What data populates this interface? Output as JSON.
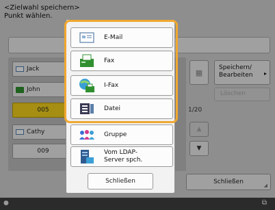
{
  "header": {
    "title_line1": "<Zielwahl speichern>",
    "title_line2": "Punkt wählen."
  },
  "list": {
    "rows": [
      {
        "label": "Jack",
        "icon": "address-card-icon",
        "selected": false
      },
      {
        "label": "John",
        "icon": "fax-icon",
        "selected": false
      },
      {
        "label": "005",
        "icon": "",
        "selected": true
      },
      {
        "label": "Cathy",
        "icon": "address-card-icon",
        "selected": false
      },
      {
        "label": "009",
        "icon": "",
        "selected": false
      }
    ]
  },
  "pager": {
    "indicator": "1/20",
    "up_icon": "triangle-up-icon",
    "down_icon": "triangle-down-icon"
  },
  "side": {
    "save_label_line1": "Speichern/",
    "save_label_line2": "Bearbeiten",
    "delete_label": "Löschen",
    "close_label": "Schließen",
    "arrow": "▸"
  },
  "popup": {
    "items": [
      {
        "label": "E-Mail",
        "icon": "email-icon"
      },
      {
        "label": "Fax",
        "icon": "fax-icon"
      },
      {
        "label": "I-Fax",
        "icon": "ifax-icon"
      },
      {
        "label": "Datei",
        "icon": "file-icon"
      },
      {
        "label": "Gruppe",
        "icon": "group-icon"
      },
      {
        "label_line1": "Vom LDAP-",
        "label_line2": "Server spch.",
        "icon": "ldap-server-icon"
      }
    ],
    "close_label": "Schließen"
  },
  "colors": {
    "selection": "#f3d21b",
    "highlight": "#f0a830",
    "fax_green": "#2f8f2f"
  }
}
